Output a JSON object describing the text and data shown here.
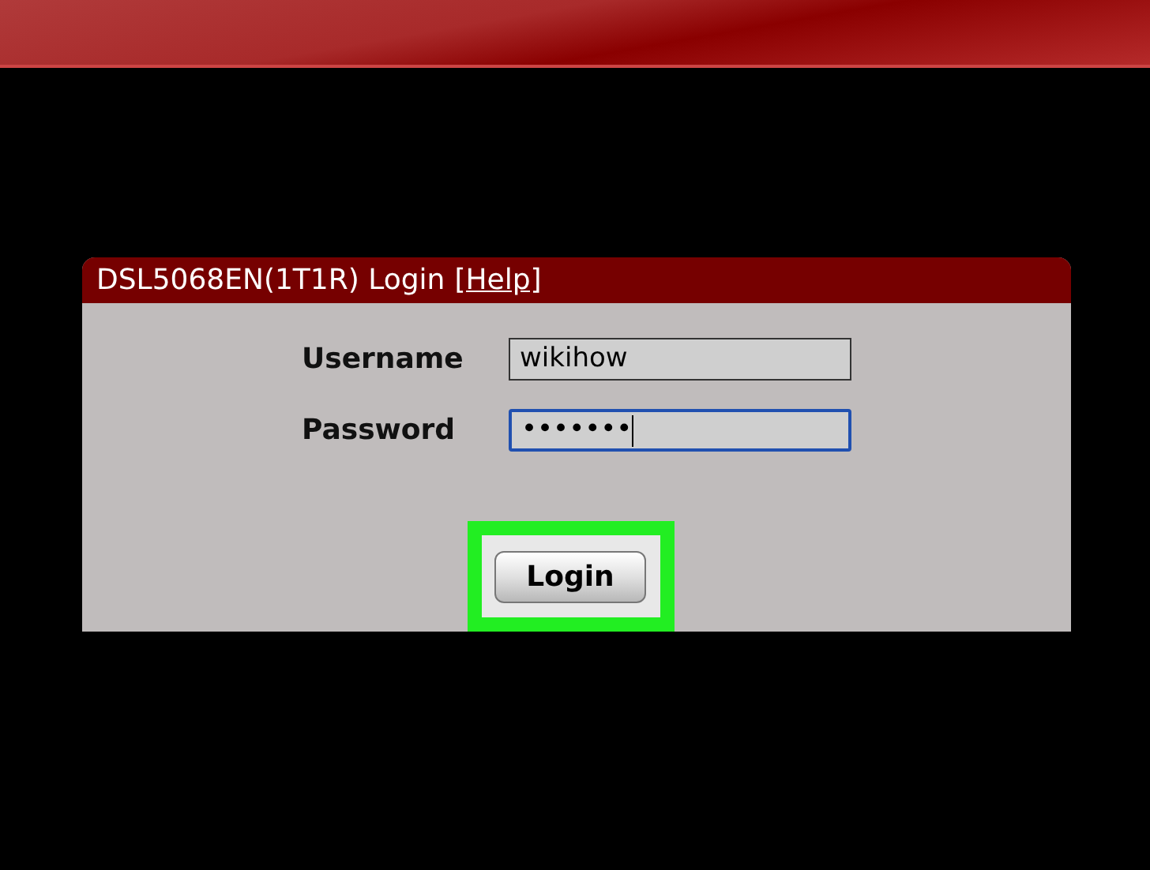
{
  "panel": {
    "title": "DSL5068EN(1T1R) Login",
    "help_link": "[Help]"
  },
  "fields": [
    {
      "label": "Username",
      "value": "wikihow",
      "focused": false
    },
    {
      "label": "Password",
      "value": "•••••••",
      "focused": true
    }
  ],
  "login_button": {
    "label": "Login",
    "highlighted": true
  }
}
